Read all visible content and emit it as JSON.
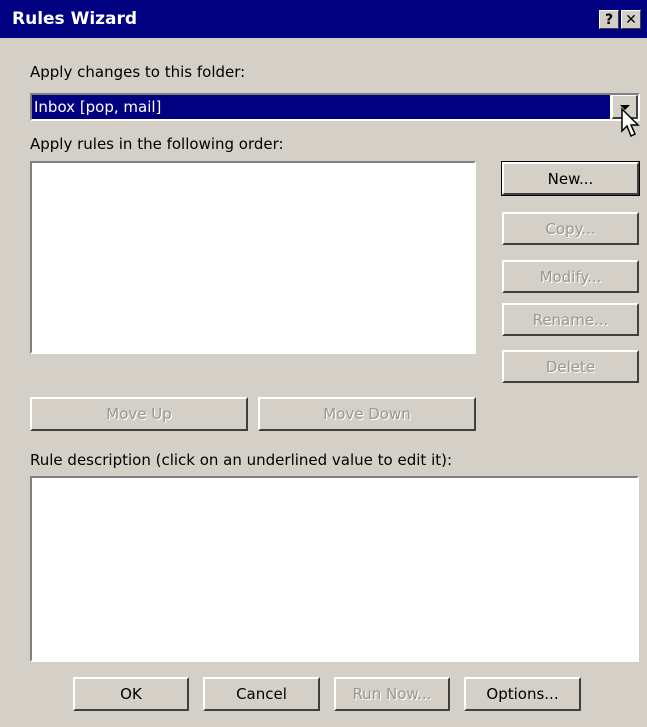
{
  "window": {
    "title": "Rules Wizard",
    "help_button": "?",
    "close_button": "✕"
  },
  "folder": {
    "label": "Apply changes to this folder:",
    "selected": "Inbox [pop, mail]"
  },
  "rules": {
    "label": "Apply rules in the following order:",
    "items": []
  },
  "side_buttons": {
    "new": "New...",
    "copy": "Copy...",
    "modify": "Modify...",
    "rename": "Rename...",
    "delete": "Delete"
  },
  "move_buttons": {
    "up": "Move Up",
    "down": "Move Down"
  },
  "description": {
    "label": "Rule description (click on an underlined value to edit it):",
    "text": ""
  },
  "footer": {
    "ok": "OK",
    "cancel": "Cancel",
    "run_now": "Run Now...",
    "options": "Options..."
  },
  "colors": {
    "titlebar": "#000080",
    "face": "#d4d0c8",
    "selection": "#000080",
    "disabled_text": "#9a9690"
  }
}
